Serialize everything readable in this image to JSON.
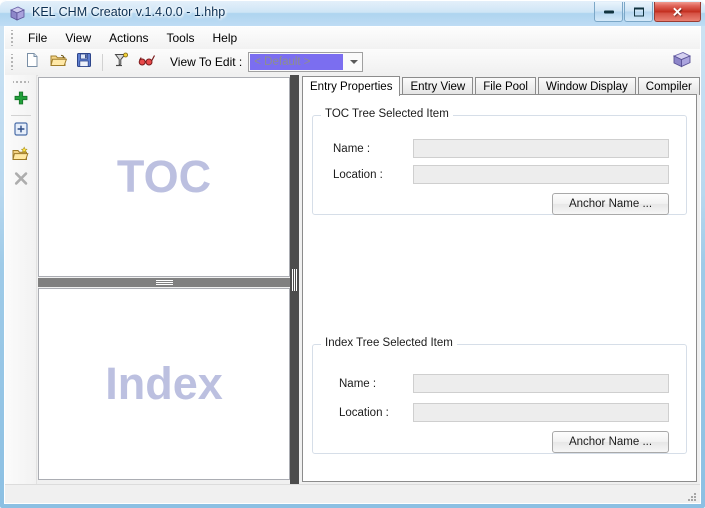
{
  "window": {
    "title": "KEL CHM Creator v.1.4.0.0 - 1.hhp",
    "icon": "book-icon",
    "minimize_label": "",
    "maximize_label": "",
    "close_label": "✕"
  },
  "menubar": {
    "items": [
      {
        "label": "File",
        "name": "menu-file"
      },
      {
        "label": "View",
        "name": "menu-view"
      },
      {
        "label": "Actions",
        "name": "menu-actions"
      },
      {
        "label": "Tools",
        "name": "menu-tools"
      },
      {
        "label": "Help",
        "name": "menu-help"
      }
    ]
  },
  "toolbar": {
    "buttons": [
      {
        "icon": "new-file-icon"
      },
      {
        "icon": "open-folder-icon"
      },
      {
        "icon": "save-icon"
      },
      {
        "icon": "compile-icon"
      },
      {
        "icon": "preview-glasses-icon"
      }
    ],
    "view_to_edit_label": "View To Edit :",
    "view_to_edit_value": "< Default >",
    "right_icon": "book-icon"
  },
  "sidebar": {
    "buttons": [
      {
        "name": "add-item-button",
        "icon": "green-plus-icon"
      },
      {
        "name": "add-child-button",
        "icon": "box-plus-icon"
      },
      {
        "name": "new-folder-button",
        "icon": "new-folder-icon"
      },
      {
        "name": "delete-button",
        "icon": "gray-x-icon"
      }
    ]
  },
  "left_pane": {
    "toc_watermark": "TOC",
    "index_watermark": "Index"
  },
  "tabs": [
    {
      "label": "Entry Properties",
      "name": "tab-entry-properties",
      "active": true
    },
    {
      "label": "Entry View",
      "name": "tab-entry-view",
      "active": false
    },
    {
      "label": "File Pool",
      "name": "tab-file-pool",
      "active": false
    },
    {
      "label": "Window Display",
      "name": "tab-window-display",
      "active": false
    },
    {
      "label": "Compiler",
      "name": "tab-compiler",
      "active": false
    }
  ],
  "toc_group": {
    "title": "TOC Tree Selected Item",
    "name_label": "Name :",
    "name_value": "",
    "location_label": "Location :",
    "location_value": "",
    "anchor_button": "Anchor Name ..."
  },
  "index_group": {
    "title": "Index Tree Selected Item",
    "name_label": "Name :",
    "name_value": "",
    "location_label": "Location :",
    "location_value": "",
    "anchor_button": "Anchor Name ..."
  },
  "statusbar": {
    "text": ""
  },
  "colors": {
    "accent_combo": "#7b6ef0",
    "watermark": "#bcc0e0",
    "splitter_vertical": "#4c4c4c",
    "splitter_horizontal": "#808080",
    "title_text": "#0c2f52"
  }
}
